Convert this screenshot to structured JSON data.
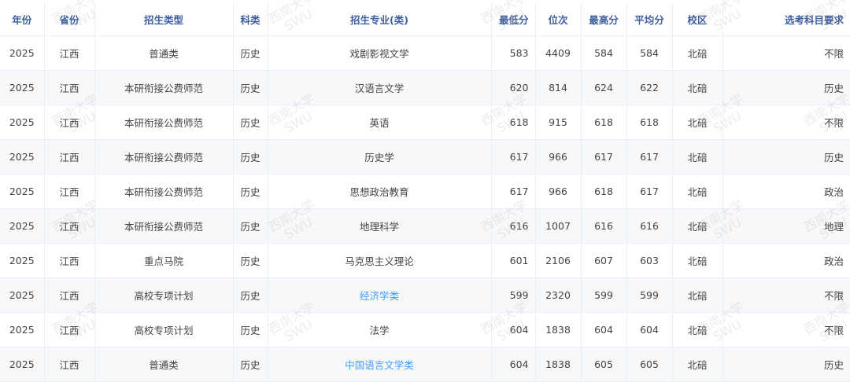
{
  "table": {
    "headers": [
      "年份",
      "省份",
      "招生类型",
      "科类",
      "招生专业(类)",
      "最低分",
      "位次",
      "最高分",
      "平均分",
      "校区",
      "选考科目要求"
    ],
    "rows": [
      {
        "year": "2025",
        "province": "江西",
        "type": "普通类",
        "subject": "历史",
        "major": "戏剧影视文学",
        "major_link": false,
        "min": "583",
        "rank": "4409",
        "max": "584",
        "avg": "584",
        "campus": "北碚",
        "req": "不限"
      },
      {
        "year": "2025",
        "province": "江西",
        "type": "本研衔接公费师范",
        "subject": "历史",
        "major": "汉语言文学",
        "major_link": false,
        "min": "620",
        "rank": "814",
        "max": "624",
        "avg": "622",
        "campus": "北碚",
        "req": "历史"
      },
      {
        "year": "2025",
        "province": "江西",
        "type": "本研衔接公费师范",
        "subject": "历史",
        "major": "英语",
        "major_link": false,
        "min": "618",
        "rank": "915",
        "max": "618",
        "avg": "618",
        "campus": "北碚",
        "req": "不限"
      },
      {
        "year": "2025",
        "province": "江西",
        "type": "本研衔接公费师范",
        "subject": "历史",
        "major": "历史学",
        "major_link": false,
        "min": "617",
        "rank": "966",
        "max": "617",
        "avg": "617",
        "campus": "北碚",
        "req": "历史"
      },
      {
        "year": "2025",
        "province": "江西",
        "type": "本研衔接公费师范",
        "subject": "历史",
        "major": "思想政治教育",
        "major_link": false,
        "min": "617",
        "rank": "966",
        "max": "618",
        "avg": "617",
        "campus": "北碚",
        "req": "政治"
      },
      {
        "year": "2025",
        "province": "江西",
        "type": "本研衔接公费师范",
        "subject": "历史",
        "major": "地理科学",
        "major_link": false,
        "min": "616",
        "rank": "1007",
        "max": "616",
        "avg": "616",
        "campus": "北碚",
        "req": "地理"
      },
      {
        "year": "2025",
        "province": "江西",
        "type": "重点马院",
        "subject": "历史",
        "major": "马克思主义理论",
        "major_link": false,
        "min": "601",
        "rank": "2106",
        "max": "607",
        "avg": "603",
        "campus": "北碚",
        "req": "政治"
      },
      {
        "year": "2025",
        "province": "江西",
        "type": "高校专项计划",
        "subject": "历史",
        "major": "经济学类",
        "major_link": true,
        "min": "599",
        "rank": "2320",
        "max": "599",
        "avg": "599",
        "campus": "北碚",
        "req": "不限"
      },
      {
        "year": "2025",
        "province": "江西",
        "type": "高校专项计划",
        "subject": "历史",
        "major": "法学",
        "major_link": false,
        "min": "604",
        "rank": "1838",
        "max": "604",
        "avg": "604",
        "campus": "北碚",
        "req": "不限"
      },
      {
        "year": "2025",
        "province": "江西",
        "type": "普通类",
        "subject": "历史",
        "major": "中国语言文学类",
        "major_link": true,
        "min": "604",
        "rank": "1838",
        "max": "605",
        "avg": "605",
        "campus": "北碚",
        "req": "历史"
      }
    ]
  },
  "watermark": {
    "line1": "西南大学",
    "line2": "SWU"
  },
  "colors": {
    "header_text": "#3f5e9e",
    "link": "#409eff",
    "stripe": "#f7f8fa",
    "border": "#ebeef5"
  }
}
